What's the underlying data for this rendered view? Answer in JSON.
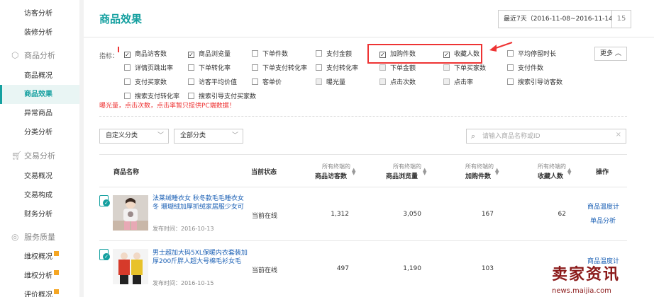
{
  "sidebar": {
    "items_top": [
      {
        "label": "访客分析"
      },
      {
        "label": "装修分析"
      }
    ],
    "groups": [
      {
        "label": "商品分析",
        "items": [
          {
            "label": "商品概况"
          },
          {
            "label": "商品效果",
            "active": true
          },
          {
            "label": "异常商品"
          },
          {
            "label": "分类分析"
          }
        ]
      },
      {
        "label": "交易分析",
        "items": [
          {
            "label": "交易概况"
          },
          {
            "label": "交易构成"
          },
          {
            "label": "财务分析"
          }
        ]
      },
      {
        "label": "服务质量",
        "items": [
          {
            "label": "维权概况",
            "badge": true
          },
          {
            "label": "维权分析",
            "badge": true
          },
          {
            "label": "评价概况",
            "badge": true
          }
        ]
      }
    ]
  },
  "header": {
    "title": "商品效果",
    "date_range": "最近7天（2016-11-08~2016-11-14）",
    "calendar_label": "15"
  },
  "indicators": {
    "label": "指标：",
    "more_label": "更多",
    "items": [
      {
        "label": "商品访客数",
        "checked": true
      },
      {
        "label": "商品浏览量",
        "checked": true
      },
      {
        "label": "下单件数",
        "checked": false
      },
      {
        "label": "支付金额",
        "checked": false
      },
      {
        "label": "加购件数",
        "checked": true
      },
      {
        "label": "收藏人数",
        "checked": true
      },
      {
        "label": "平均停留时长",
        "checked": false
      },
      {
        "label": "详情页跳出率",
        "checked": false
      },
      {
        "label": "下单转化率",
        "checked": false
      },
      {
        "label": "下单支付转化率",
        "checked": false
      },
      {
        "label": "支付转化率",
        "checked": false
      },
      {
        "label": "下单金额",
        "checked": false,
        "disabled": true
      },
      {
        "label": "下单买家数",
        "checked": false,
        "disabled": true
      },
      {
        "label": "支付件数",
        "checked": false
      },
      {
        "label": "支付买家数",
        "checked": false
      },
      {
        "label": "访客平均价值",
        "checked": false
      },
      {
        "label": "客单价",
        "checked": false
      },
      {
        "label": "曝光量",
        "checked": false,
        "disabled": true
      },
      {
        "label": "点击次数",
        "checked": false,
        "disabled": true
      },
      {
        "label": "点击率",
        "checked": false,
        "disabled": true
      },
      {
        "label": "搜索引导访客数",
        "checked": false
      },
      {
        "label": "搜索支付转化率",
        "checked": false
      },
      {
        "label": "搜索引导支付买家数",
        "checked": false
      }
    ],
    "note": "曝光量，点击次数，点击率暂只提供PC端数据！"
  },
  "filters": {
    "custom_category": "自定义分类",
    "all_category": "全部分类",
    "search_placeholder": "请输入商品名称或ID"
  },
  "table": {
    "headers": {
      "name": "商品名称",
      "status": "当前状态",
      "uv_sub": "所有终端的",
      "uv": "商品访客数",
      "pv_sub": "所有终端的",
      "pv": "商品浏览量",
      "cart_sub": "所有终端的",
      "cart": "加购件数",
      "fav_sub": "所有终端的",
      "fav": "收藏人数",
      "op": "操作"
    },
    "rows": [
      {
        "name": "法莱绒睡衣女 秋冬款毛毛睡衣女冬 珊瑚绒加厚抓绒家居服少女可",
        "date": "发布时间：2016-10-13",
        "status": "当前在线",
        "uv": "1,312",
        "pv": "3,050",
        "cart": "167",
        "fav": "62",
        "op1": "商品温度计",
        "op2": "单品分析"
      },
      {
        "name": "男士超加大码5XL保暖内衣套装加厚200斤胖人超大号棉毛衫女毛",
        "date": "发布时间：2016-10-15",
        "status": "当前在线",
        "uv": "497",
        "pv": "1,190",
        "cart": "103",
        "fav": "",
        "op1": "商品温度计",
        "op2": ""
      }
    ]
  },
  "watermark": {
    "big": "卖家资讯",
    "small": "news.maijia.com"
  },
  "colors": {
    "accent": "#15a0a0",
    "link": "#1a5fb4",
    "alert": "#e33333"
  }
}
